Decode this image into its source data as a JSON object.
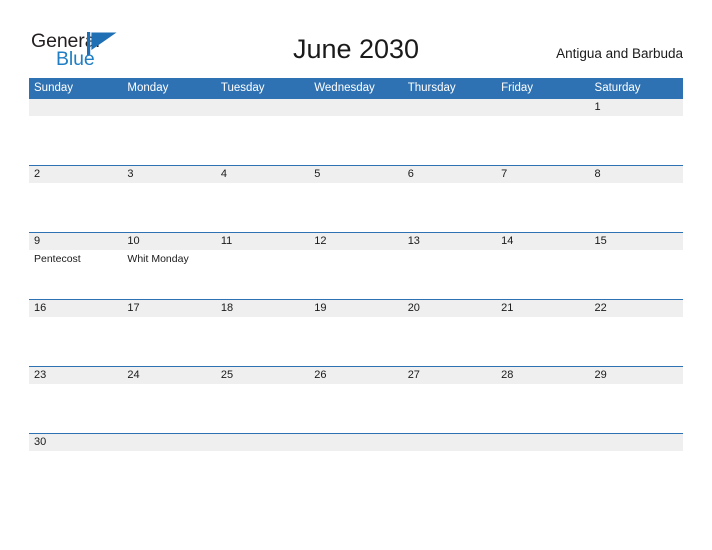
{
  "brand": {
    "word_top": "General",
    "word_bottom": "Blue",
    "flag_icon": "blue-triangle-flag-icon",
    "color_dark": "#231f20",
    "color_blue": "#1f7ec4"
  },
  "header": {
    "title": "June 2030",
    "region": "Antigua and Barbuda"
  },
  "theme": {
    "header_blue": "#2f72b3",
    "band_grey": "#efefef",
    "rule_blue": "#2f72b3",
    "text_dark": "#1a1a1a",
    "text_white": "#ffffff"
  },
  "calendar": {
    "weekdays": [
      "Sunday",
      "Monday",
      "Tuesday",
      "Wednesday",
      "Thursday",
      "Friday",
      "Saturday"
    ],
    "weeks": [
      {
        "days": [
          {
            "num": "",
            "event": ""
          },
          {
            "num": "",
            "event": ""
          },
          {
            "num": "",
            "event": ""
          },
          {
            "num": "",
            "event": ""
          },
          {
            "num": "",
            "event": ""
          },
          {
            "num": "",
            "event": ""
          },
          {
            "num": "1",
            "event": ""
          }
        ]
      },
      {
        "days": [
          {
            "num": "2",
            "event": ""
          },
          {
            "num": "3",
            "event": ""
          },
          {
            "num": "4",
            "event": ""
          },
          {
            "num": "5",
            "event": ""
          },
          {
            "num": "6",
            "event": ""
          },
          {
            "num": "7",
            "event": ""
          },
          {
            "num": "8",
            "event": ""
          }
        ]
      },
      {
        "days": [
          {
            "num": "9",
            "event": "Pentecost"
          },
          {
            "num": "10",
            "event": "Whit Monday"
          },
          {
            "num": "11",
            "event": ""
          },
          {
            "num": "12",
            "event": ""
          },
          {
            "num": "13",
            "event": ""
          },
          {
            "num": "14",
            "event": ""
          },
          {
            "num": "15",
            "event": ""
          }
        ]
      },
      {
        "days": [
          {
            "num": "16",
            "event": ""
          },
          {
            "num": "17",
            "event": ""
          },
          {
            "num": "18",
            "event": ""
          },
          {
            "num": "19",
            "event": ""
          },
          {
            "num": "20",
            "event": ""
          },
          {
            "num": "21",
            "event": ""
          },
          {
            "num": "22",
            "event": ""
          }
        ]
      },
      {
        "days": [
          {
            "num": "23",
            "event": ""
          },
          {
            "num": "24",
            "event": ""
          },
          {
            "num": "25",
            "event": ""
          },
          {
            "num": "26",
            "event": ""
          },
          {
            "num": "27",
            "event": ""
          },
          {
            "num": "28",
            "event": ""
          },
          {
            "num": "29",
            "event": ""
          }
        ]
      },
      {
        "days": [
          {
            "num": "30",
            "event": ""
          },
          {
            "num": "",
            "event": ""
          },
          {
            "num": "",
            "event": ""
          },
          {
            "num": "",
            "event": ""
          },
          {
            "num": "",
            "event": ""
          },
          {
            "num": "",
            "event": ""
          },
          {
            "num": "",
            "event": ""
          }
        ]
      }
    ]
  }
}
